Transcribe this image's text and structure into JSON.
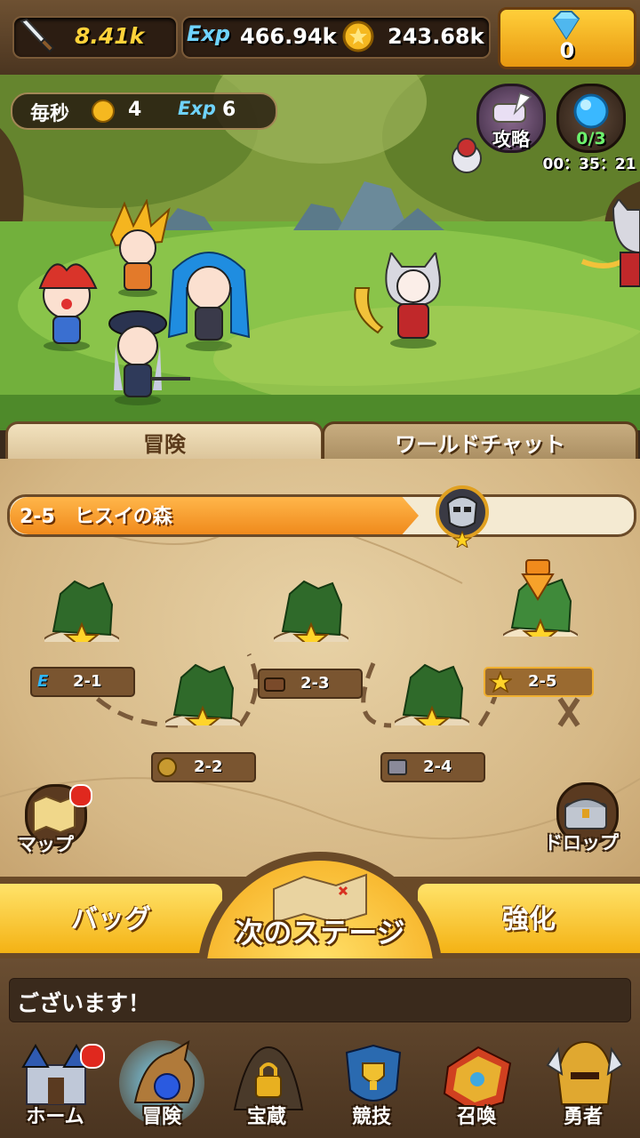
{
  "header": {
    "attack_value": "8.41k",
    "exp_label": "Exp",
    "exp_value": "466.94k",
    "gold_value": "243.68k",
    "gem_count": "0"
  },
  "rate": {
    "prefix": "毎秒",
    "gold_per_sec": "4",
    "exp_label": "Exp",
    "exp_per_sec": "6"
  },
  "battle": {
    "guide_label": "攻略",
    "orb_count": "0/3",
    "timer": "00：35：21"
  },
  "tabs": [
    "冒険",
    "ワールドチャット"
  ],
  "stage_bar": {
    "title": "2-5　ヒスイの森"
  },
  "stages": [
    {
      "label": "2-1",
      "badge": "E"
    },
    {
      "label": "2-2",
      "badge": "coin"
    },
    {
      "label": "2-3",
      "badge": "chest"
    },
    {
      "label": "2-4",
      "badge": "box"
    },
    {
      "label": "2-5",
      "badge": "star"
    }
  ],
  "map_buttons": {
    "map_label": "マップ",
    "drop_label": "ドロップ"
  },
  "actions": {
    "bag_label": "バッグ",
    "next_stage_label": "次のステージ",
    "upgrade_label": "強化"
  },
  "chat": {
    "message": "ございます！"
  },
  "nav": [
    "ホーム",
    "冒険",
    "宝蔵",
    "競技",
    "召喚",
    "勇者"
  ],
  "colors": {
    "accent_yellow": "#f4b214",
    "stage_bar_orange": "#f08a1c",
    "notify_red": "#e0281e"
  }
}
